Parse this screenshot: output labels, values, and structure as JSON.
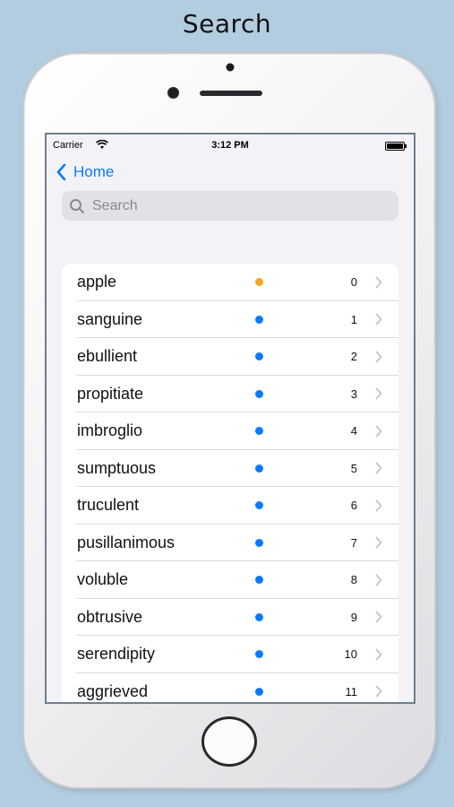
{
  "caption": "Search",
  "status_bar": {
    "carrier": "Carrier",
    "time": "3:12 PM"
  },
  "nav": {
    "back_label": "Home"
  },
  "search": {
    "placeholder": "Search",
    "value": ""
  },
  "colors": {
    "accent": "#0a7aff",
    "orange_dot": "#f5a623",
    "blue_dot": "#0a7aff"
  },
  "words": [
    {
      "word": "apple",
      "count": "0",
      "dot": "orange"
    },
    {
      "word": "sanguine",
      "count": "1",
      "dot": "blue"
    },
    {
      "word": "ebullient",
      "count": "2",
      "dot": "blue"
    },
    {
      "word": "propitiate",
      "count": "3",
      "dot": "blue"
    },
    {
      "word": "imbroglio",
      "count": "4",
      "dot": "blue"
    },
    {
      "word": "sumptuous",
      "count": "5",
      "dot": "blue"
    },
    {
      "word": "truculent",
      "count": "6",
      "dot": "blue"
    },
    {
      "word": "pusillanimous",
      "count": "7",
      "dot": "blue"
    },
    {
      "word": "voluble",
      "count": "8",
      "dot": "blue"
    },
    {
      "word": "obtrusive",
      "count": "9",
      "dot": "blue"
    },
    {
      "word": "serendipity",
      "count": "10",
      "dot": "blue"
    },
    {
      "word": "aggrieved",
      "count": "11",
      "dot": "blue"
    }
  ]
}
